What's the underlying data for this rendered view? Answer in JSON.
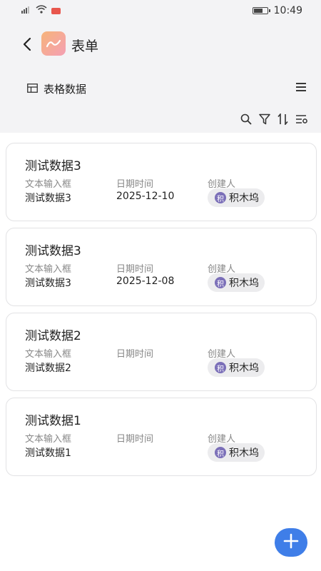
{
  "status_bar": {
    "time": "10:49",
    "battery_level": 0.75
  },
  "header": {
    "title": "表单",
    "view_name": "表格数据"
  },
  "records": [
    {
      "title": "测试数据3",
      "fields": [
        {
          "label": "文本输入框",
          "value": "测试数据3"
        },
        {
          "label": "日期时间",
          "value": "2025-12-10"
        },
        {
          "label": "创建人"
        }
      ],
      "creator": {
        "avatar": "积",
        "name": "积木坞"
      }
    },
    {
      "title": "测试数据3",
      "fields": [
        {
          "label": "文本输入框",
          "value": "测试数据3"
        },
        {
          "label": "日期时间",
          "value": "2025-12-08"
        },
        {
          "label": "创建人"
        }
      ],
      "creator": {
        "avatar": "积",
        "name": "积木坞"
      }
    },
    {
      "title": "测试数据2",
      "fields": [
        {
          "label": "文本输入框",
          "value": "测试数据2"
        },
        {
          "label": "日期时间",
          "value": ""
        },
        {
          "label": "创建人"
        }
      ],
      "creator": {
        "avatar": "积",
        "name": "积木坞"
      }
    },
    {
      "title": "测试数据1",
      "fields": [
        {
          "label": "文本输入框",
          "value": "测试数据1"
        },
        {
          "label": "日期时间",
          "value": ""
        },
        {
          "label": "创建人"
        }
      ],
      "creator": {
        "avatar": "积",
        "name": "积木坞"
      }
    }
  ],
  "colors": {
    "accent": "#3f7ee8",
    "header_bg": "#f3f3f5",
    "avatar_bg": "#7b6fb8"
  },
  "icons": {
    "back": "chevron-left-icon",
    "menu": "hamburger-icon",
    "search": "search-icon",
    "filter": "filter-icon",
    "sort": "sort-icon",
    "settings": "list-settings-icon",
    "add": "plus-icon"
  }
}
